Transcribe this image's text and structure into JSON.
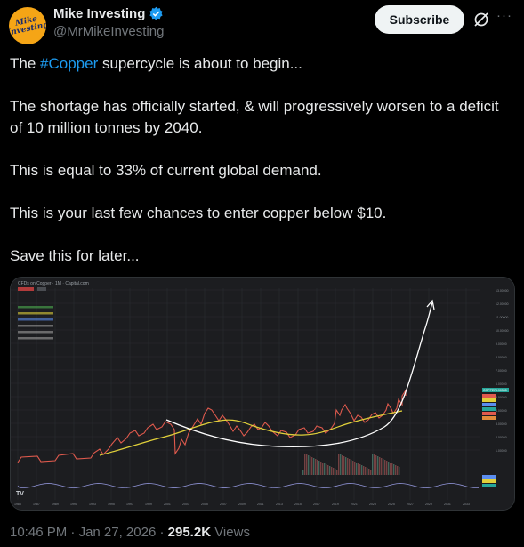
{
  "author": {
    "name": "Mike Investing",
    "handle": "@MrMikeInvesting",
    "avatar_text": "Mike Investing",
    "verified_color": "#1d9bf0"
  },
  "actions": {
    "subscribe_label": "Subscribe",
    "grok_icon": "grok-icon",
    "more_icon": "more-icon",
    "more_label": "···"
  },
  "post": {
    "line1_prefix": "The ",
    "hashtag": "#Copper",
    "line1_suffix": " supercycle is about to begin...",
    "line2": "The shortage has officially started, & will progressively worsen to a deficit of 10 million tonnes by 2040.",
    "line3": "This is equal to 33% of current global demand.",
    "line4": "This is your last few chances to enter copper below $10.",
    "line5": "Save this for later..."
  },
  "chart_image": {
    "title": "CFDs on Copper · 1M · Capital.com",
    "x_labels": [
      "1985",
      "1987",
      "1989",
      "1991",
      "1993",
      "1995",
      "1997",
      "1999",
      "2001",
      "2003",
      "2005",
      "2007",
      "2009",
      "2011",
      "2013",
      "2015",
      "2017",
      "2019",
      "2021",
      "2023",
      "2025",
      "2027",
      "2029",
      "2031",
      "2033"
    ],
    "y_labels": [
      "13.00000",
      "12.00000",
      "11.00000",
      "10.00000",
      "9.00000",
      "8.00000",
      "7.00000",
      "6.00000",
      "5.00000",
      "4.00000",
      "3.00000",
      "2.00000",
      "1.00000"
    ],
    "price_tag": "COPPER",
    "price_value": "5.90345",
    "colors": {
      "price": "#e05a4d",
      "ma": "#e0d03a",
      "curve": "#ffffff",
      "bg": "#1c1d20"
    }
  },
  "meta": {
    "time": "10:46 PM",
    "sep1": " · ",
    "date": "Jan 27, 2026",
    "sep2": " · ",
    "views_count": "295.2K",
    "views_label": " Views"
  }
}
